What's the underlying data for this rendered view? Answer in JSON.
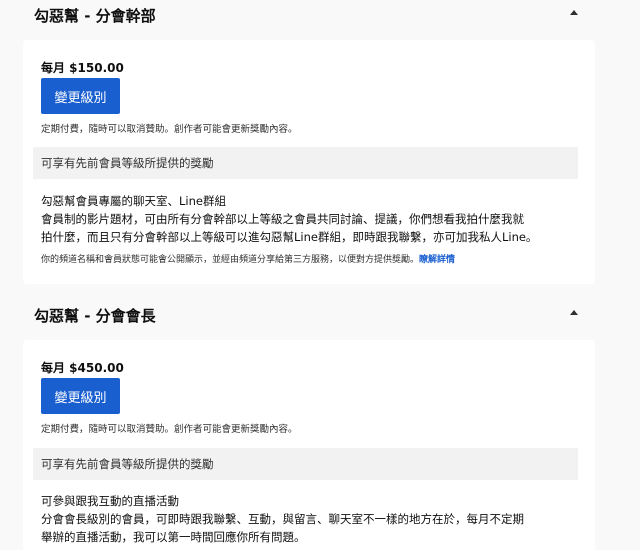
{
  "tiers": [
    {
      "title": "勾惡幫 - 分會幹部",
      "price": "每月 $150.00",
      "button_label": "變更級別",
      "note": "定期付費，隨時可以取消贊助。創作者可能會更新獎勵內容。",
      "prior_perks": "可享有先前會員等級所提供的獎勵",
      "perk_title": "勾惡幫會員專屬的聊天室、Line群組",
      "perk_lines": [
        "會員制的影片題材，可由所有分會幹部以上等級之會員共同討論、提議，你們想看我拍什麼我就",
        "拍什麼，而且只有分會幹部以上等級可以進勾惡幫Line群組，即時跟我聯繫，亦可加我私人Line。"
      ],
      "privacy_text": "你的頻道名稱和會員狀態可能會公開顯示，並經由頻道分享給第三方服務，以便對方提供獎勵。",
      "learn_more": "瞭解詳情"
    },
    {
      "title": "勾惡幫 - 分會會長",
      "price": "每月 $450.00",
      "button_label": "變更級別",
      "note": "定期付費，隨時可以取消贊助。創作者可能會更新獎勵內容。",
      "prior_perks": "可享有先前會員等級所提供的獎勵",
      "perk_title": "可參與跟我互動的直播活動",
      "perk_lines": [
        "分會會長級別的會員，可即時跟我聯繫、互動，與留言、聊天室不一樣的地方在於，每月不定期",
        "舉辦的直播活動，我可以第一時間回應你所有問題。"
      ]
    }
  ]
}
